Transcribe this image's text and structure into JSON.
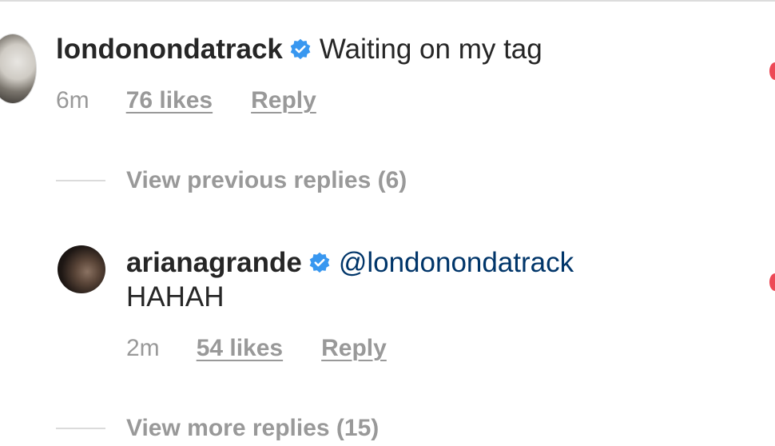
{
  "comments": [
    {
      "username": "londonondatrack",
      "verified": true,
      "text": "Waiting on my tag",
      "time": "6m",
      "likes": "76 likes",
      "reply_label": "Reply",
      "avatar": "avatar-londonondatrack"
    },
    {
      "username": "arianagrande",
      "verified": true,
      "mention": "@londonondatrack",
      "text": "HAHAH",
      "time": "2m",
      "likes": "54 likes",
      "reply_label": "Reply",
      "avatar": "avatar-arianagrande"
    }
  ],
  "view_previous_replies": "View previous replies (6)",
  "view_more_replies": "View more replies (15)",
  "colors": {
    "text": "#262626",
    "meta": "#999999",
    "verified_badge": "#3897f0",
    "mention": "#003569",
    "like_heart": "#ed4956"
  },
  "icons": {
    "verified": "verified-badge-icon",
    "like": "heart-icon"
  }
}
